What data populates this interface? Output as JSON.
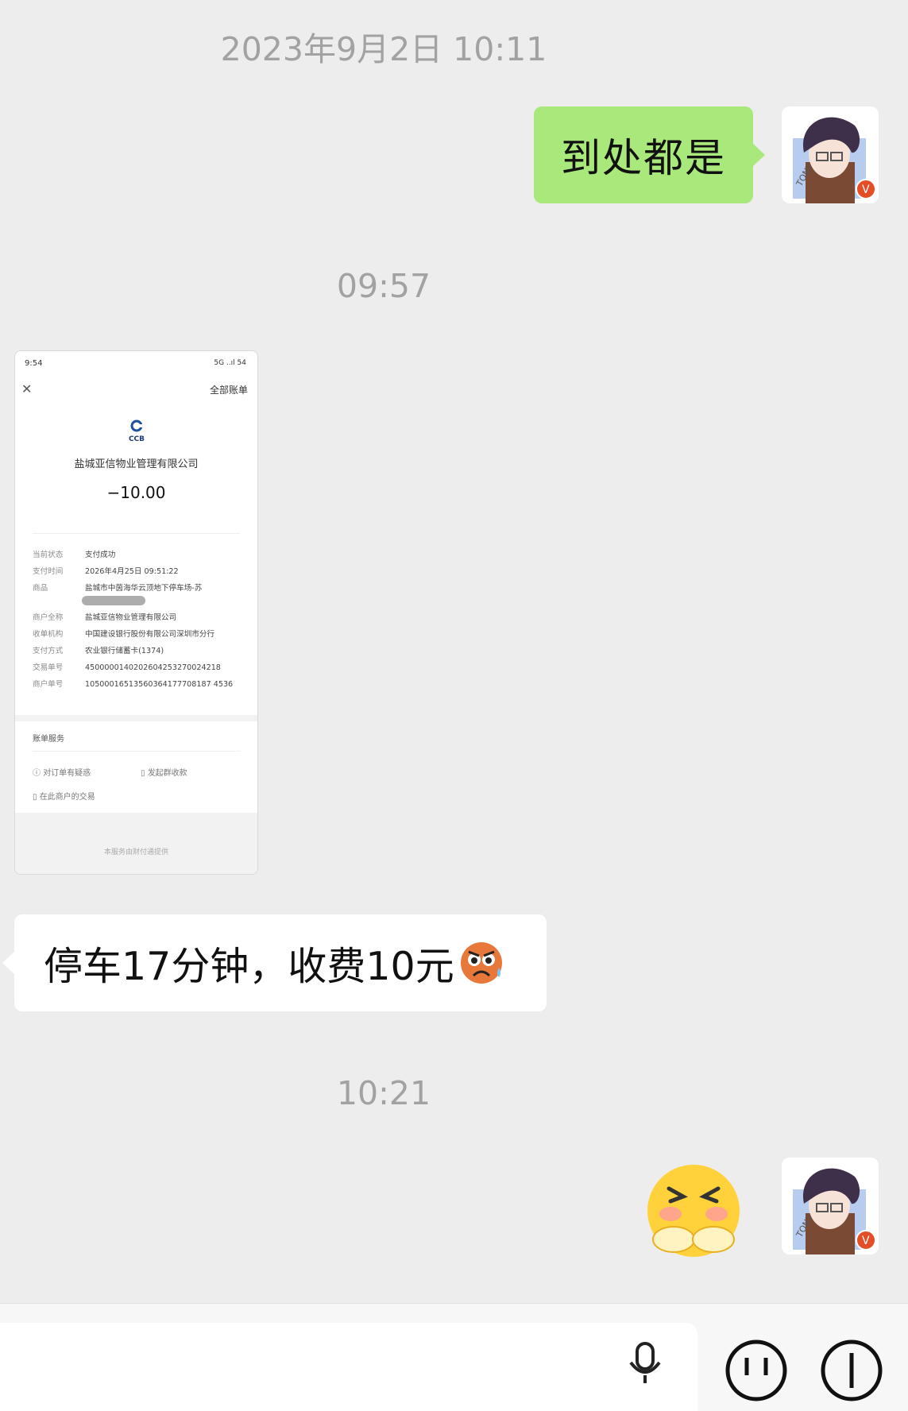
{
  "messages": {
    "ts1": "2023年9月2日 10:11",
    "msg1": "到处都是",
    "ts2": "09:57",
    "ts3": "10:21",
    "msg2": "停车17分钟，收费10元",
    "avatar_label": "TONY",
    "avatar_badge": "V"
  },
  "receipt": {
    "status_time": "9:54",
    "status_right": "5G ..ıl 54",
    "all_bills": "全部账单",
    "bank_logo": "CCB",
    "merchant": "盐城亚信物业管理有限公司",
    "amount": "−10.00",
    "fields": [
      {
        "k": "当前状态",
        "v": "支付成功"
      },
      {
        "k": "支付时间",
        "v": "2026年4月25日 09:51:22"
      },
      {
        "k": "商品",
        "v": "盐城市中茵海华云顶地下停车场-苏"
      },
      {
        "k": "商户全称",
        "v": "盐城亚信物业管理有限公司"
      },
      {
        "k": "收单机构",
        "v": "中国建设银行股份有限公司深圳市分行"
      },
      {
        "k": "支付方式",
        "v": "农业银行储蓄卡(1374)"
      },
      {
        "k": "交易单号",
        "v": "4500000140202604253270024218"
      },
      {
        "k": "商户单号",
        "v": "10500016513560364177708187 4536"
      }
    ],
    "service_title": "账单服务",
    "link1": "对订单有疑惑",
    "link2": "发起群收款",
    "link3": "在此商户的交易",
    "footer": "本服务由财付通提供"
  },
  "colors": {
    "bg": "#ededed",
    "green_bubble": "#a9e97b",
    "timestamp": "#a2a2a2"
  },
  "icons": [
    "voice-icon",
    "emoji-icon",
    "plus-icon"
  ]
}
